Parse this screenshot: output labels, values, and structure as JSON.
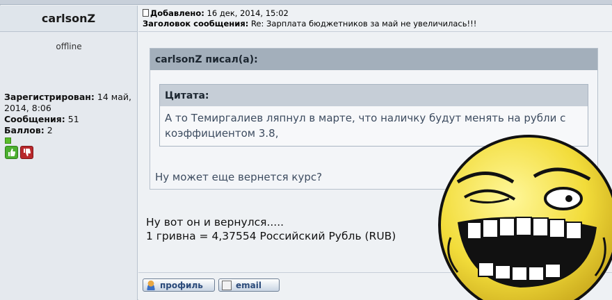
{
  "author": {
    "name": "carlsonZ",
    "status": "offline",
    "registered_label": "Зарегистрирован:",
    "registered_value": "14 май, 2014, 8:06",
    "messages_label": "Сообщения:",
    "messages_value": "51",
    "points_label": "Баллов:",
    "points_value": "2"
  },
  "post": {
    "added_label": "Добавлено:",
    "added_value": "16 дек, 2014, 15:02",
    "subject_label": "Заголовок сообщения:",
    "subject_value": "Re: Зарплата бюджетников за май не увеличилась!!!"
  },
  "quote": {
    "outer_title": "carlsonZ писал(а):",
    "inner_title": "Цитата:",
    "inner_text": "А то Темиргалиев ляпнул в марте, что наличку будут менять на рубли с коэффициентом 3.8,",
    "outer_text": "Ну может еще вернется курс?"
  },
  "message": {
    "line1": "Ну вот он и вернулся.....",
    "line2": "1 гривна = 4,37554 Российский Рубль (RUB)"
  },
  "buttons": {
    "profile": "профиль",
    "email": "email"
  },
  "icons": [
    "document-icon",
    "thumb-up-icon",
    "thumb-down-icon",
    "person-icon",
    "mail-icon"
  ]
}
